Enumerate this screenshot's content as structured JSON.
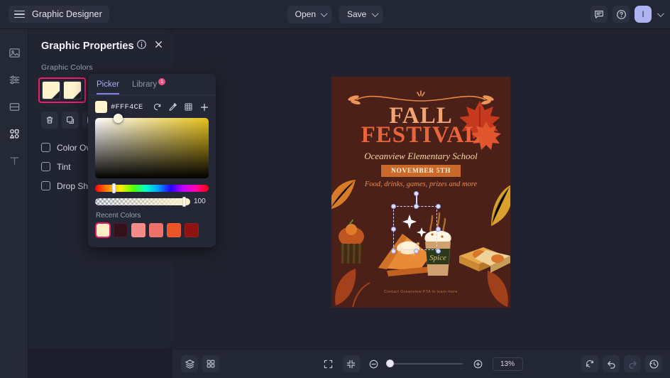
{
  "app": {
    "title": "Graphic Designer",
    "menu_icon": "hamburger-icon"
  },
  "topbar": {
    "open_label": "Open",
    "save_label": "Save",
    "comment_icon": "comment-icon",
    "help_icon": "help-circle-icon",
    "avatar_initial": "I"
  },
  "rail": {
    "items": [
      {
        "icon": "image-icon",
        "name": "sidebar-item-image"
      },
      {
        "icon": "adjustments-icon",
        "name": "sidebar-item-adjustments"
      },
      {
        "icon": "layout-icon",
        "name": "sidebar-item-layout"
      },
      {
        "icon": "shapes-icon",
        "name": "sidebar-item-shapes"
      },
      {
        "icon": "text-icon",
        "name": "sidebar-item-text"
      }
    ]
  },
  "panel": {
    "title": "Graphic Properties",
    "info_icon": "info-icon",
    "close_icon": "close-icon",
    "section_label": "Graphic Colors",
    "swatches": [
      {
        "color": "#FFF4CE"
      },
      {
        "color": "#FFF4CE"
      }
    ],
    "highlight_color": "#EC1E6B",
    "tools": [
      {
        "icon": "trash-icon",
        "name": "delete-color-button"
      },
      {
        "icon": "duplicate-icon",
        "name": "duplicate-color-button"
      }
    ],
    "effects": [
      {
        "label": "Color Overlay",
        "checked": false
      },
      {
        "label": "Tint",
        "checked": false
      },
      {
        "label": "Drop Shadow",
        "checked": false
      }
    ]
  },
  "picker": {
    "tabs": [
      {
        "label": "Picker",
        "active": true,
        "badge": ""
      },
      {
        "label": "Library",
        "active": false,
        "badge": "1"
      }
    ],
    "hex": "#FFF4CE",
    "swatch_color": "#FFF4CE",
    "tools": [
      {
        "icon": "refresh-icon",
        "name": "reset-color-button"
      },
      {
        "icon": "eyedropper-icon",
        "name": "eyedropper-button"
      },
      {
        "icon": "palette-grid-icon",
        "name": "palette-grid-button"
      },
      {
        "icon": "plus-icon",
        "name": "add-color-button"
      }
    ],
    "alpha": "100",
    "recent_label": "Recent Colors",
    "recent_colors": [
      {
        "color": "#FDEFC3",
        "selected": true
      },
      {
        "color": "#33101A",
        "selected": false
      },
      {
        "color": "#F68A86",
        "selected": false
      },
      {
        "color": "#EE6F67",
        "selected": false
      },
      {
        "color": "#EB5526",
        "selected": false
      },
      {
        "color": "#8E1310",
        "selected": false
      }
    ]
  },
  "poster": {
    "bg_color": "#4A2018",
    "title_line1": "FALL",
    "title_line2": "FESTIVAL",
    "school": "Oceanview Elementary School",
    "date": "NOVEMBER 5TH",
    "tagline": "Food, drinks, games, prizes and more",
    "footer": "Contact Oceanview PTA to learn more"
  },
  "bottombar": {
    "layers_icon": "layers-icon",
    "grid_icon": "grid-icon",
    "fit_screen_icon": "fit-to-screen-icon",
    "fit_selection_icon": "fit-selection-icon",
    "zoom_out_icon": "zoom-out-icon",
    "zoom_in_icon": "zoom-in-icon",
    "zoom_value": "13%",
    "refresh_icon": "refresh-icon",
    "undo_icon": "undo-icon",
    "redo_icon": "redo-icon",
    "history_icon": "history-icon"
  }
}
